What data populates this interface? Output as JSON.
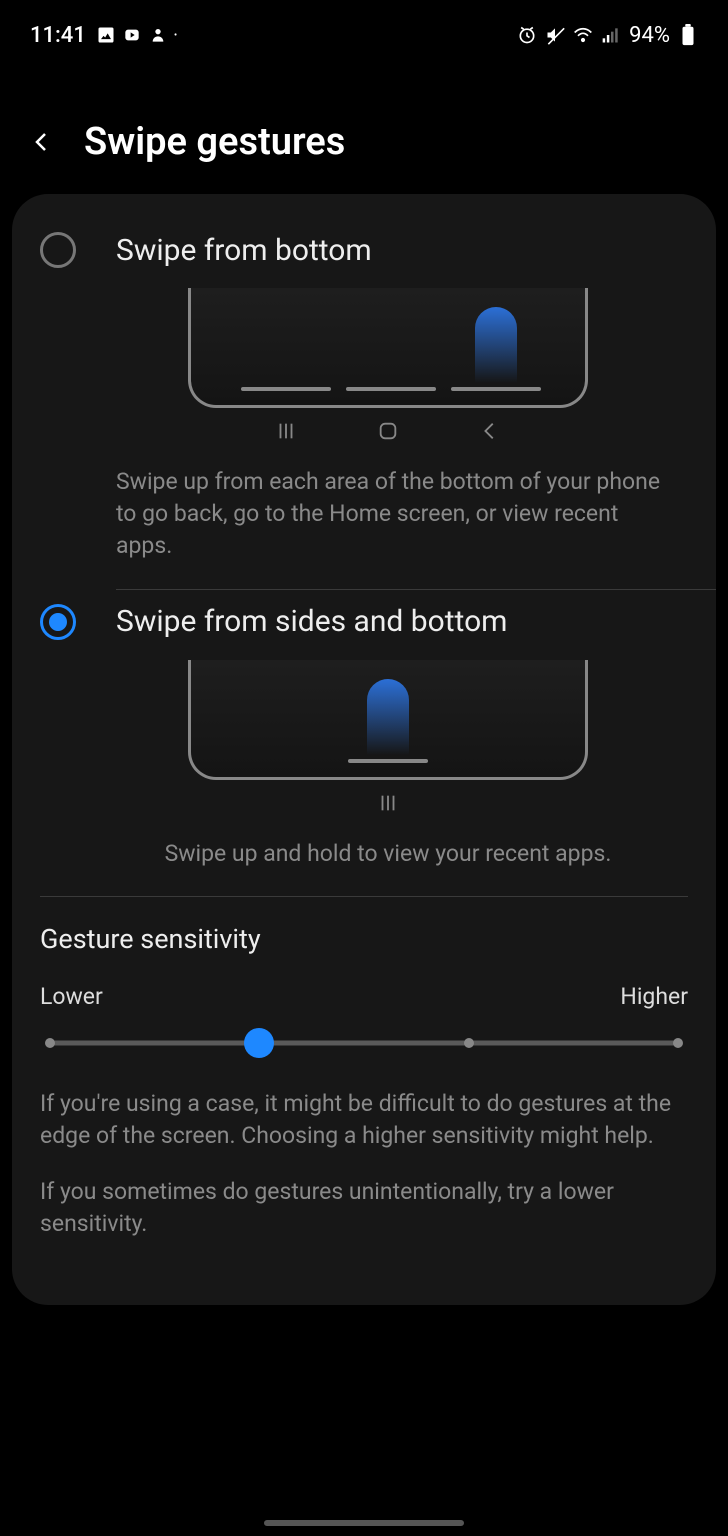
{
  "status": {
    "time": "11:41",
    "battery": "94%"
  },
  "header": {
    "title": "Swipe gestures"
  },
  "options": [
    {
      "title": "Swipe from bottom",
      "desc": "Swipe up from each area of the bottom of your phone to go back, go to the Home screen, or view recent apps."
    },
    {
      "title": "Swipe from sides and bottom",
      "desc": "Swipe up and hold to view your recent apps."
    }
  ],
  "sensitivity": {
    "title": "Gesture sensitivity",
    "lower": "Lower",
    "higher": "Higher",
    "desc1": "If you're using a case, it might be difficult to do gestures at the edge of the screen. Choosing a higher sensitivity might help.",
    "desc2": "If you sometimes do gestures unintentionally, try a lower sensitivity."
  }
}
